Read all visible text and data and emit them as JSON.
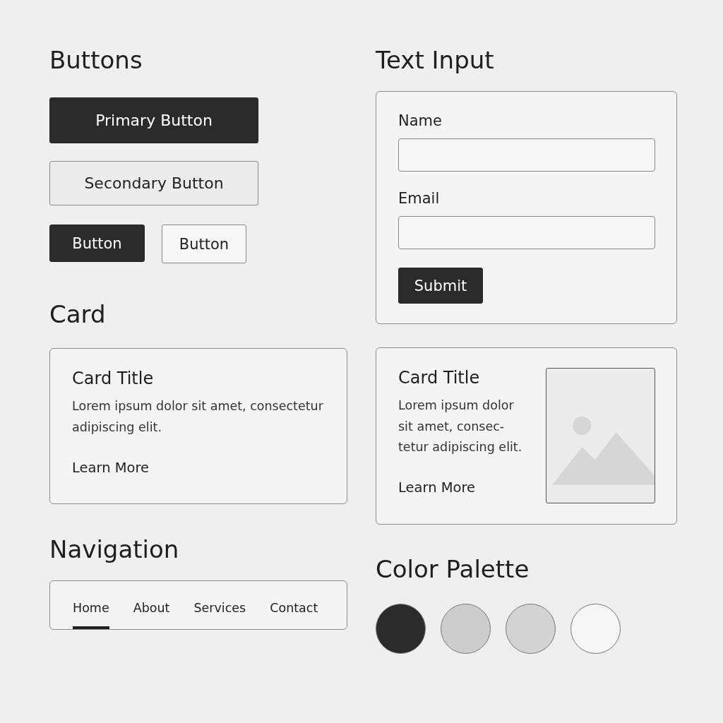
{
  "buttons_section": {
    "heading": "Buttons",
    "buttons": [
      {
        "label": "Primary Button",
        "kind": "primary-large"
      },
      {
        "label": "Secondary Button",
        "kind": "secondary-large"
      },
      {
        "label": "Button",
        "kind": "primary-small"
      },
      {
        "label": "Button",
        "kind": "outline-small"
      }
    ]
  },
  "card_section": {
    "heading": "Card",
    "card": {
      "title": "Card Title",
      "lines": [
        "Lorem ipsum dolor sit amet, consectetur",
        "adipiscing elit."
      ],
      "link": "Learn More"
    }
  },
  "navigation_section": {
    "heading": "Navigation",
    "items": [
      {
        "label": "Home",
        "selected": true
      },
      {
        "label": "About",
        "selected": false
      },
      {
        "label": "Services",
        "selected": false
      },
      {
        "label": "Contact",
        "selected": false
      }
    ]
  },
  "text_input_section": {
    "heading": "Text Input",
    "fields": [
      {
        "label": "Name"
      },
      {
        "label": "Email"
      }
    ],
    "submit": "Submit"
  },
  "image_card": {
    "title": "Card Title",
    "lines": [
      "Lorem ipsum dolor",
      "sit amet, consec-",
      "tetur adipiscing elit."
    ],
    "link": "Learn More"
  },
  "color_palette": {
    "heading": "Color Palette",
    "swatches": [
      {
        "color": "#2b2b2b"
      },
      {
        "color": "#cdcdcd"
      },
      {
        "color": "#d3d3d3"
      },
      {
        "color": "#f6f6f6"
      }
    ]
  }
}
